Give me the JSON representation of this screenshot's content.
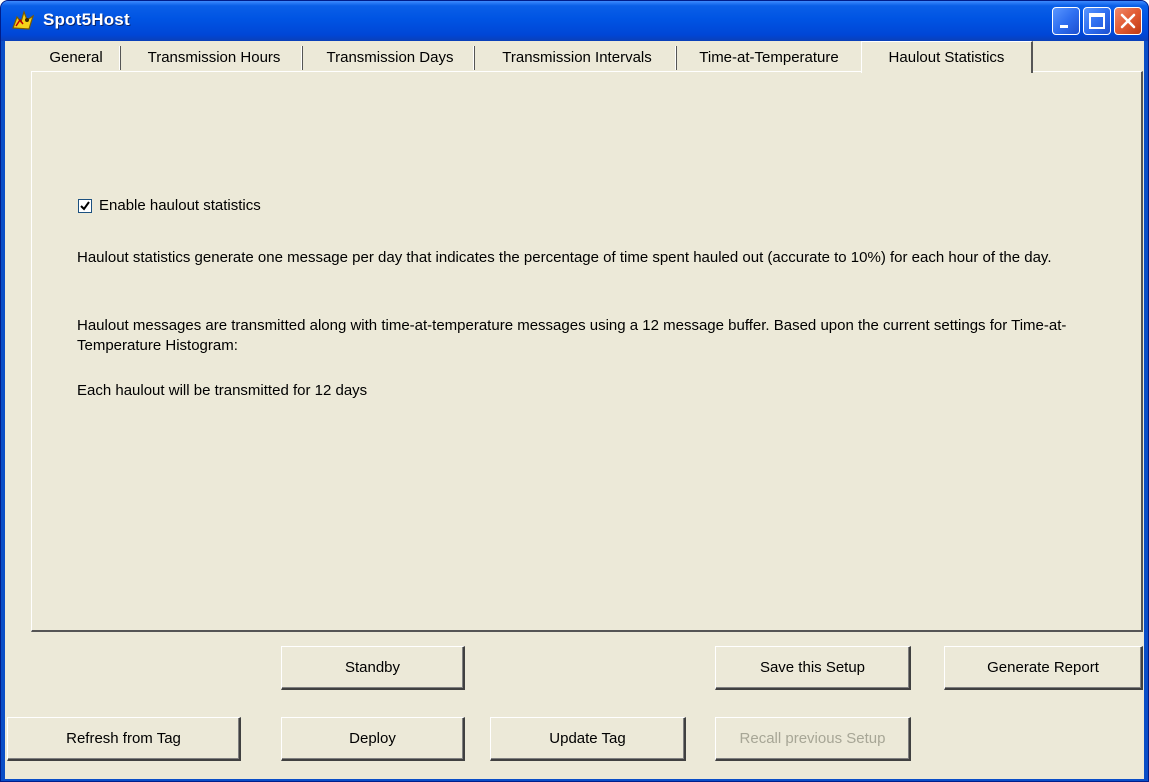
{
  "window": {
    "title": "Spot5Host"
  },
  "tabs": [
    {
      "label": "General",
      "active": false
    },
    {
      "label": "Transmission Hours",
      "active": false
    },
    {
      "label": "Transmission Days",
      "active": false
    },
    {
      "label": "Transmission Intervals",
      "active": false
    },
    {
      "label": "Time-at-Temperature",
      "active": false
    },
    {
      "label": "Haulout Statistics",
      "active": true
    }
  ],
  "haulout": {
    "enable_label": "Enable haulout statistics",
    "enable_checked": true,
    "para1": "Haulout statistics generate one message per day that indicates the percentage of time spent hauled out (accurate to 10%) for each hour of the day.",
    "para2": "Haulout messages are transmitted along with time-at-temperature messages using a 12 message buffer.  Based upon the current settings for Time-at-Temperature Histogram:",
    "para3": "Each haulout will be transmitted for 12 days"
  },
  "buttons": {
    "standby": "Standby",
    "save_setup": "Save this Setup",
    "generate_report": "Generate Report",
    "refresh_from_tag": "Refresh from Tag",
    "deploy": "Deploy",
    "update_tag": "Update Tag",
    "recall_previous_setup": "Recall previous Setup",
    "recall_enabled": false
  },
  "icons": {
    "app": "spot5host-app-icon",
    "minimize": "minimize-icon",
    "maximize": "maximize-icon",
    "close": "close-icon"
  },
  "colors": {
    "titlebar": "#0054e3",
    "client": "#ece9d8",
    "close_button": "#e15b33",
    "disabled_text": "#a7a696"
  }
}
